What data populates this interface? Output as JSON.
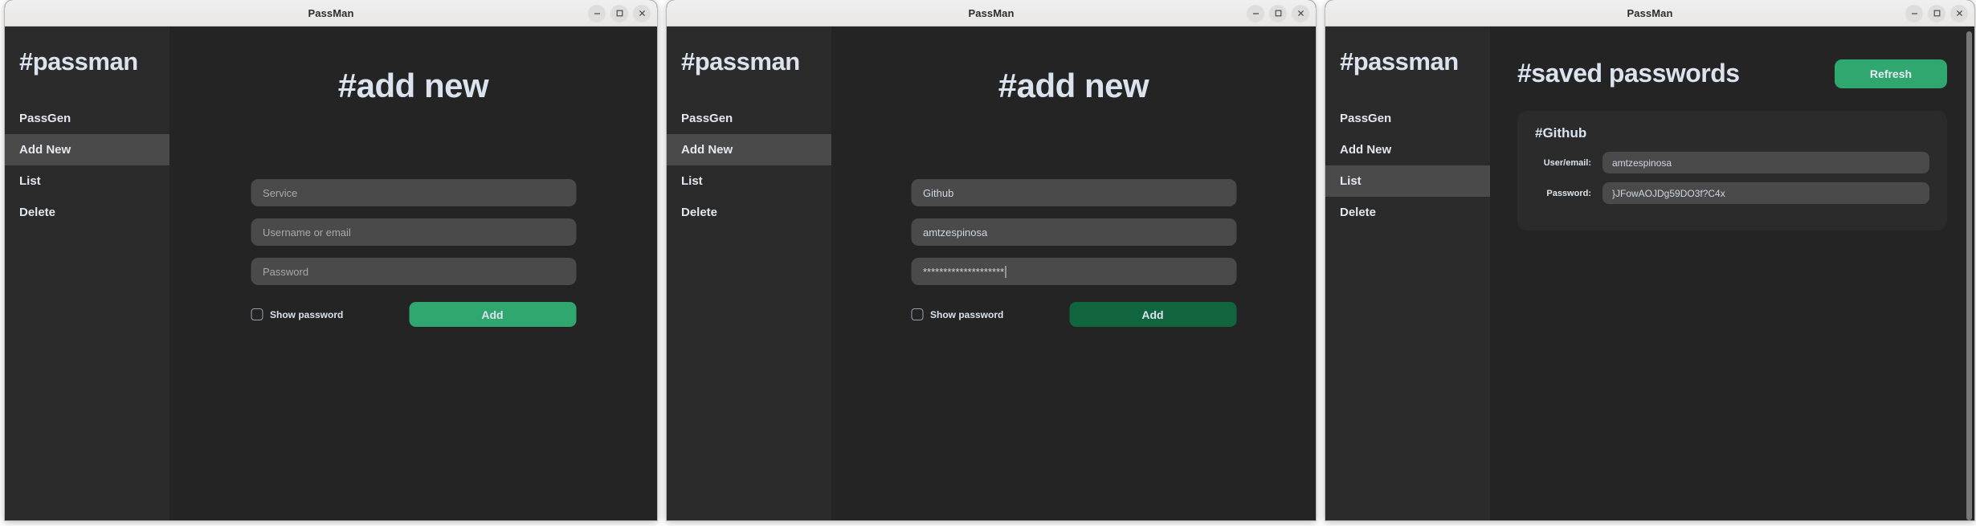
{
  "windows": [
    {
      "titlebar": {
        "title": "PassMan",
        "minimize_label": "minimize",
        "maximize_label": "maximize",
        "close_label": "close"
      },
      "sidebar": {
        "brand": "#passman",
        "items": [
          {
            "label": "PassGen",
            "active": false
          },
          {
            "label": "Add New",
            "active": true
          },
          {
            "label": "List",
            "active": false
          },
          {
            "label": "Delete",
            "active": false
          }
        ]
      },
      "page": {
        "kind": "add",
        "title": "#add new",
        "fields": [
          {
            "name": "service",
            "value": "",
            "placeholder": "Service",
            "caret": false
          },
          {
            "name": "username",
            "value": "",
            "placeholder": "Username or email",
            "caret": false
          },
          {
            "name": "password",
            "value": "",
            "placeholder": "Password",
            "caret": false
          }
        ],
        "show_password_label": "Show password",
        "show_password_checked": false,
        "submit_label": "Add",
        "submit_style": "bright"
      }
    },
    {
      "titlebar": {
        "title": "PassMan",
        "minimize_label": "minimize",
        "maximize_label": "maximize",
        "close_label": "close"
      },
      "sidebar": {
        "brand": "#passman",
        "items": [
          {
            "label": "PassGen",
            "active": false
          },
          {
            "label": "Add New",
            "active": true
          },
          {
            "label": "List",
            "active": false
          },
          {
            "label": "Delete",
            "active": false
          }
        ]
      },
      "page": {
        "kind": "add",
        "title": "#add new",
        "fields": [
          {
            "name": "service",
            "value": "Github",
            "placeholder": "Service",
            "caret": false
          },
          {
            "name": "username",
            "value": "amtzespinosa",
            "placeholder": "Username or email",
            "caret": false
          },
          {
            "name": "password",
            "value": "********************",
            "placeholder": "Password",
            "caret": true
          }
        ],
        "show_password_label": "Show password",
        "show_password_checked": false,
        "submit_label": "Add",
        "submit_style": "dark"
      }
    },
    {
      "titlebar": {
        "title": "PassMan",
        "minimize_label": "minimize",
        "maximize_label": "maximize",
        "close_label": "close"
      },
      "sidebar": {
        "brand": "#passman",
        "items": [
          {
            "label": "PassGen",
            "active": false
          },
          {
            "label": "Add New",
            "active": false
          },
          {
            "label": "List",
            "active": true
          },
          {
            "label": "Delete",
            "active": false
          }
        ]
      },
      "page": {
        "kind": "list",
        "title": "#saved passwords",
        "refresh_label": "Refresh",
        "entries": [
          {
            "name": "#Github",
            "rows": [
              {
                "label": "User/email:",
                "value": "amtzespinosa"
              },
              {
                "label": "Password:",
                "value": "}JFowAOJDg59DO3f?C4x"
              }
            ]
          }
        ]
      }
    }
  ],
  "colors": {
    "accent_green": "#2fa76f",
    "accent_green_dark": "#11663f",
    "sidebar_bg": "#2b2b2b",
    "content_bg": "#242424",
    "field_bg": "#4a4a4a",
    "text_primary": "#dbe3ee"
  }
}
